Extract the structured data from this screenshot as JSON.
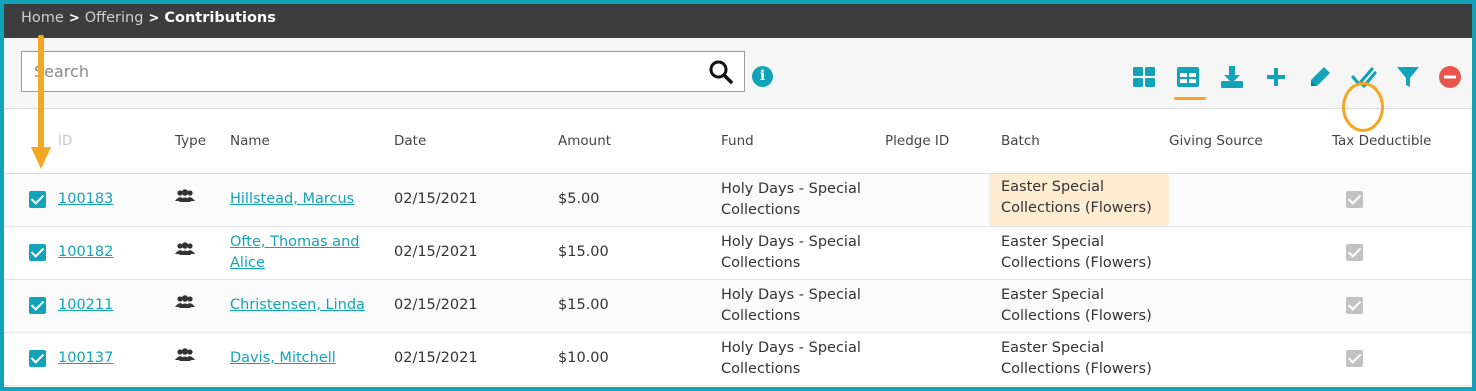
{
  "breadcrumb": {
    "items": [
      "Home",
      "Offering",
      "Contributions"
    ],
    "separator": ">"
  },
  "search": {
    "placeholder": "Search",
    "value": ""
  },
  "toolbar": {
    "info_label": "i",
    "icons": [
      "grid-view-icon",
      "table-view-icon",
      "download-icon",
      "add-icon",
      "edit-icon",
      "mark-all-checked-icon",
      "filter-icon",
      "delete-icon"
    ],
    "active_view": "table-view-icon",
    "highlighted": "mark-all-checked-icon"
  },
  "table": {
    "columns": [
      "ID",
      "Type",
      "Name",
      "Date",
      "Amount",
      "Fund",
      "Pledge ID",
      "Batch",
      "Giving Source",
      "Tax Deductible"
    ],
    "rows": [
      {
        "checked": true,
        "id": "100183",
        "type_icon": "group-icon",
        "name": "Hillstead, Marcus",
        "date": "02/15/2021",
        "amount": "$5.00",
        "fund": "Holy Days - Special Collections",
        "pledge_id": "",
        "batch": "Easter Special Collections (Flowers)",
        "giving_source": "",
        "tax_deductible": true
      },
      {
        "checked": true,
        "id": "100182",
        "type_icon": "group-icon",
        "name": "Ofte, Thomas and Alice",
        "date": "02/15/2021",
        "amount": "$15.00",
        "fund": "Holy Days - Special Collections",
        "pledge_id": "",
        "batch": "Easter Special Collections (Flowers)",
        "giving_source": "",
        "tax_deductible": true
      },
      {
        "checked": true,
        "id": "100211",
        "type_icon": "group-icon",
        "name": "Christensen, Linda",
        "date": "02/15/2021",
        "amount": "$15.00",
        "fund": "Holy Days - Special Collections",
        "pledge_id": "",
        "batch": "Easter Special Collections (Flowers)",
        "giving_source": "",
        "tax_deductible": true
      },
      {
        "checked": true,
        "id": "100137",
        "type_icon": "group-icon",
        "name": "Davis, Mitchell",
        "date": "02/15/2021",
        "amount": "$10.00",
        "fund": "Holy Days - Special Collections",
        "pledge_id": "",
        "batch": "Easter Special Collections (Flowers)",
        "giving_source": "",
        "tax_deductible": true
      }
    ]
  },
  "colors": {
    "accent": "#13a3b9",
    "header_bar": "#3d3d3d",
    "annotation": "#f5a623",
    "highlight_cell": "#fcecd1",
    "delete": "#e8554e"
  }
}
